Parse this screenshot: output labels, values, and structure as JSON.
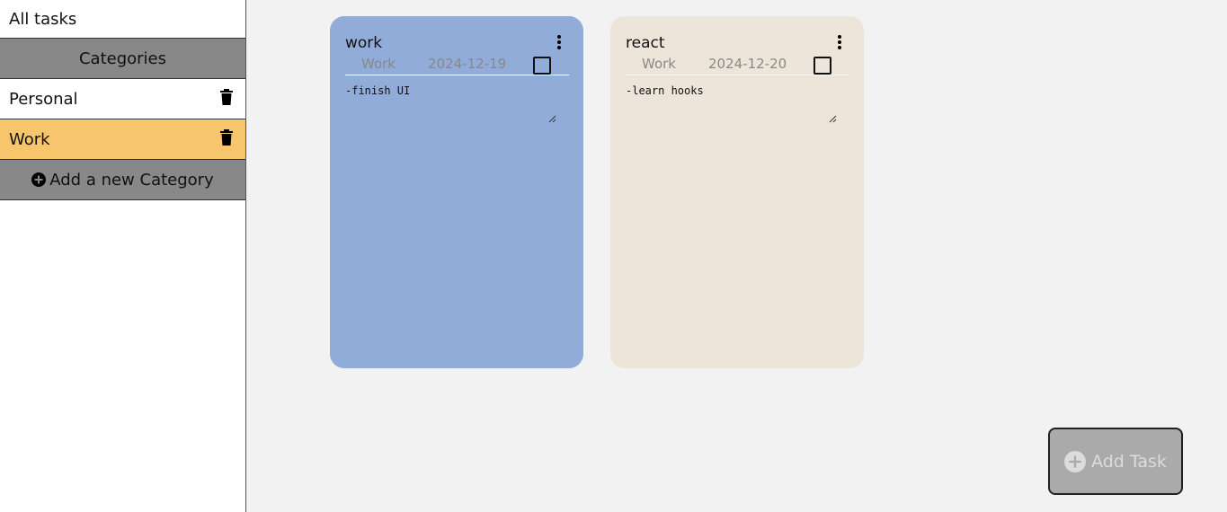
{
  "sidebar": {
    "all_tasks": "All tasks",
    "categories_header": "Categories",
    "categories": [
      {
        "label": "Personal",
        "active": false
      },
      {
        "label": "Work",
        "active": true
      }
    ],
    "add_category": "Add a new Category"
  },
  "cards": [
    {
      "title": "work",
      "category": "Work",
      "date": "2024-12-19",
      "note": "-finish UI",
      "color": "#91acd8"
    },
    {
      "title": "react",
      "category": "Work",
      "date": "2024-12-20",
      "note": "-learn hooks",
      "color": "#ede5d9"
    }
  ],
  "add_task": "Add Task",
  "colors": {
    "active_category": "#f7c56b",
    "header_gray": "#888888"
  },
  "icons": [
    "trash-icon",
    "plus-circle-icon",
    "kebab-menu-icon",
    "checkbox",
    "resize-grip-icon"
  ]
}
